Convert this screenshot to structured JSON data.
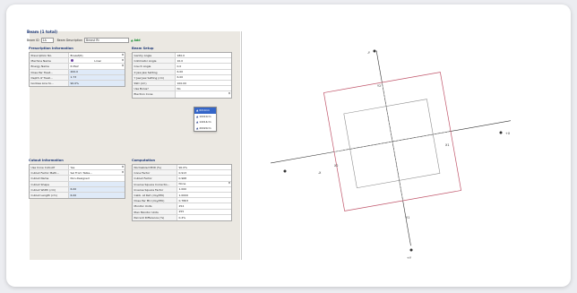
{
  "app": {
    "title": "Beam (1 total)"
  },
  "toolbar": {
    "beam_label": "Beam ID",
    "beam_value": "1A",
    "beam_desc_label": "Beam Description",
    "beam_desc_value": "Breast Rt",
    "add_label": "Add"
  },
  "prescription": {
    "title": "Prescription Information",
    "rows": [
      {
        "label": "Prescription No.",
        "value": "Breast(R)"
      },
      {
        "label": "Machine Name",
        "value": "Linac"
      },
      {
        "label": "Energy Name",
        "value": "6 MeV"
      },
      {
        "label": "Dose Per Treat...",
        "value": "200.0"
      },
      {
        "label": "Depth of Treat...",
        "value": "1.73"
      },
      {
        "label": "Isodose Line to...",
        "value": "90.0%"
      }
    ]
  },
  "beam_setup": {
    "title": "Beam Setup",
    "rows": [
      {
        "label": "Gantry Angle",
        "value": "180.0"
      },
      {
        "label": "Collimator Angle",
        "value": "10.0"
      },
      {
        "label": "Couch Angle",
        "value": "0.0"
      },
      {
        "label": "X Jaw Jaw Setting",
        "value": "6.00"
      },
      {
        "label": "Y Jaw Jaw Setting (cm)",
        "value": "6.00"
      },
      {
        "label": "SSD (cm)",
        "value": "100.00"
      },
      {
        "label": "Use Bolus?",
        "value": "No"
      },
      {
        "label": "Electron Cone",
        "value": ""
      }
    ],
    "cone_options": [
      "6X10cm",
      "10X10cm",
      "14X14cm",
      "20X20cm"
    ]
  },
  "cutout": {
    "title": "Cutout Information",
    "rows": [
      {
        "label": "Use Cone Cutout?",
        "value": "Yes"
      },
      {
        "label": "Cutout Factor Meth...",
        "value": "Sel From Table..."
      },
      {
        "label": "Cutout Name",
        "value": "Non-Designed"
      },
      {
        "label": "Cutout Shape",
        "value": ""
      },
      {
        "label": "Cutout Width (cm)",
        "value": "6.00"
      },
      {
        "label": "Cutout Length (cm)",
        "value": "6.00"
      }
    ]
  },
  "computation": {
    "title": "Computation",
    "rows": [
      {
        "label": "Normalized PDD (%)",
        "value": "90.0%"
      },
      {
        "label": "Cone Factor",
        "value": "0.913"
      },
      {
        "label": "Cutout Factor",
        "value": "0.968"
      },
      {
        "label": "Inverse Square Correctio...",
        "value": "None"
      },
      {
        "label": "Inverse Square Factor",
        "value": "1.000"
      },
      {
        "label": "Calib. at Ref. (cGy/MU)",
        "value": "1.0000"
      },
      {
        "label": "Dose Per MU (cGy/MU)",
        "value": "0.7863"
      },
      {
        "label": "Monitor Units",
        "value": "254"
      },
      {
        "label": "Plan Monitor Units",
        "value": "255"
      },
      {
        "label": "Percent Difference (%)",
        "value": "0.4%"
      }
    ]
  },
  "plot": {
    "labels": {
      "top": "-Y",
      "right": "+X",
      "bottom": "+Y",
      "left": "-X",
      "inner_top": "Y2",
      "inner_right": "X1",
      "inner_bottom": "Y1",
      "inner_left": "X2"
    },
    "colors": {
      "jaw": "#c0556a",
      "cutout": "#8e8e8e",
      "axis": "#333333",
      "crosshair": "#b9b9b9"
    },
    "collimator_angle": 10
  }
}
